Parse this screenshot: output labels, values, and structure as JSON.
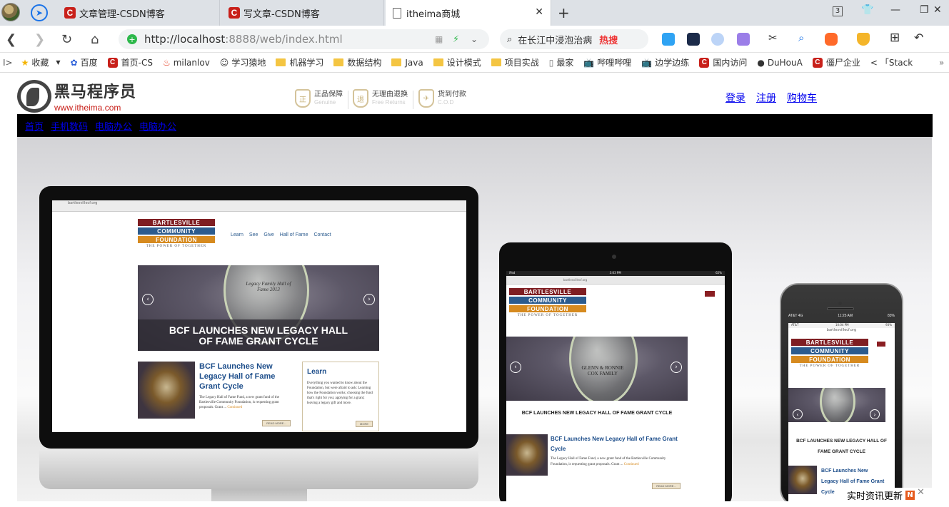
{
  "browser": {
    "tabs": [
      {
        "label": "文章管理-CSDN博客",
        "active": false
      },
      {
        "label": "写文章-CSDN博客",
        "active": false
      },
      {
        "label": "itheima商城",
        "active": true
      }
    ],
    "tab_count_badge": "3",
    "url_host": "http://localhost",
    "url_rest": ":8888/web/index.html",
    "search_text": "在长江中浸泡治病",
    "search_hot": "热搜",
    "bookmarks": [
      {
        "label": "收藏",
        "icon": "star-icon"
      },
      {
        "label": "百度",
        "icon": "baidu-icon"
      },
      {
        "label": "首页-CS",
        "icon": "csdn-icon"
      },
      {
        "label": "milanlov",
        "icon": "flame-icon"
      },
      {
        "label": "学习猿地",
        "icon": "monkey-icon"
      },
      {
        "label": "机器学习",
        "icon": "folder-icon"
      },
      {
        "label": "数据结构",
        "icon": "folder-icon"
      },
      {
        "label": "Java",
        "icon": "folder-icon"
      },
      {
        "label": "设计模式",
        "icon": "folder-icon"
      },
      {
        "label": "项目实战",
        "icon": "folder-icon"
      },
      {
        "label": "最家",
        "icon": "page-icon"
      },
      {
        "label": "哔哩哔哩",
        "icon": "bilibili-icon"
      },
      {
        "label": "边学边练",
        "icon": "bilibili-icon"
      },
      {
        "label": "国内访问",
        "icon": "csdn-icon"
      },
      {
        "label": "DuHouA",
        "icon": "github-icon"
      },
      {
        "label": "僵尸企业",
        "icon": "csdn-icon"
      },
      {
        "label": "「Stack",
        "icon": "code-icon"
      }
    ]
  },
  "site": {
    "logo_cn": "黑马程序员",
    "logo_en": "www.itheima.com",
    "guarantees": [
      {
        "title": "正品保障",
        "subtitle": "Genuine",
        "icon": "正"
      },
      {
        "title": "无理由退换",
        "subtitle": "Free Returns",
        "icon": "退"
      },
      {
        "title": "货到付款",
        "subtitle": "C.O.D",
        "icon": "✈"
      }
    ],
    "top_links": [
      "登录",
      "注册",
      "购物车"
    ],
    "menu": [
      "首页",
      "手机数码",
      "电脑办公",
      "电脑办公"
    ]
  },
  "banner": {
    "url": "bartlesvillecf.org",
    "brand": {
      "line1": "BARTLESVILLE",
      "line2": "COMMUNITY",
      "line3": "FOUNDATION",
      "tagline": "THE POWER OF TOGETHER"
    },
    "nav": [
      "Learn",
      "See",
      "Give",
      "Hall of Fame",
      "Contact"
    ],
    "hero_caption": "BCF LAUNCHES NEW LEGACY HALL OF FAME GRANT CYCLE",
    "hero_glass_text": "Legacy Family Hall of Fame 2013",
    "tablet_glass_text": "GLENN & RONNIE COX FAMILY",
    "card_title": "BCF Launches New Legacy Hall of Fame Grant Cycle",
    "card_body": "The Legacy Hall of Fame Fund, a new grant fund of the Bartlesville Community Foundation, is requesting grant proposals. Grant ...",
    "continued": "Continued",
    "read_more": "READ MORE...",
    "learn_title": "Learn",
    "learn_body": "Everything you wanted to know about the Foundation, but were afraid to ask: Learning how the Foundation works; choosing the fund that's right for you; applying for a grant; leaving a legacy gift and more.",
    "more": "MORE",
    "tablet_status": {
      "left": "iPad",
      "time": "3:03 PM",
      "battery": "62%"
    },
    "phone_status": {
      "left": "AT&T 4G",
      "time": "11:25 AM",
      "battery": "83%"
    },
    "phone_status2": {
      "left": "AT&T",
      "time": "10:04 PM",
      "battery": "93%"
    }
  },
  "notification": {
    "label": "实时资讯更新",
    "badge": "N"
  }
}
